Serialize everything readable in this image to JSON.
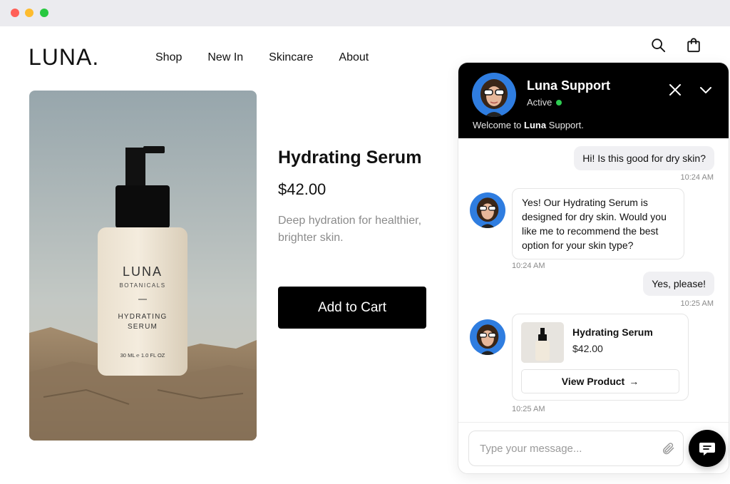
{
  "brand": {
    "logo": "LUNA."
  },
  "nav": {
    "items": [
      "Shop",
      "New In",
      "Skincare",
      "About"
    ]
  },
  "header_icons": [
    "search-icon",
    "shopping-bag-icon"
  ],
  "product": {
    "title": "Hydrating Serum",
    "price": "$42.00",
    "description": "Deep hydration for healthier, brighter skin.",
    "add_to_cart_label": "Add to Cart",
    "bottle_label": {
      "brand": "LUNA",
      "sub": "BOTANICALS",
      "name_line1": "HYDRATING",
      "name_line2": "SERUM",
      "volume": "30 ML  ℮ 1.0 FL OZ"
    }
  },
  "chat": {
    "agent_name": "Luna Support",
    "status": "Active",
    "welcome_prefix": "Welcome to ",
    "welcome_brand": "Luna",
    "welcome_suffix": " Support.",
    "messages": [
      {
        "from": "user",
        "text": "Hi! Is this good for dry skin?",
        "time": "10:24 AM"
      },
      {
        "from": "agent",
        "text": "Yes! Our Hydrating Serum is designed for dry skin. Would you like me to recommend the best option for your skin type?",
        "time": "10:24 AM"
      },
      {
        "from": "user",
        "text": "Yes, please!",
        "time": "10:25 AM"
      },
      {
        "from": "agent",
        "time": "10:25 AM"
      }
    ],
    "product_card": {
      "title": "Hydrating Serum",
      "price": "$42.00",
      "button_label": "View Product",
      "button_arrow": "→"
    },
    "input_placeholder": "Type your message..."
  },
  "colors": {
    "brand_black": "#000000",
    "status_green": "#2ecc52",
    "muted_text": "#8b8b8b"
  }
}
